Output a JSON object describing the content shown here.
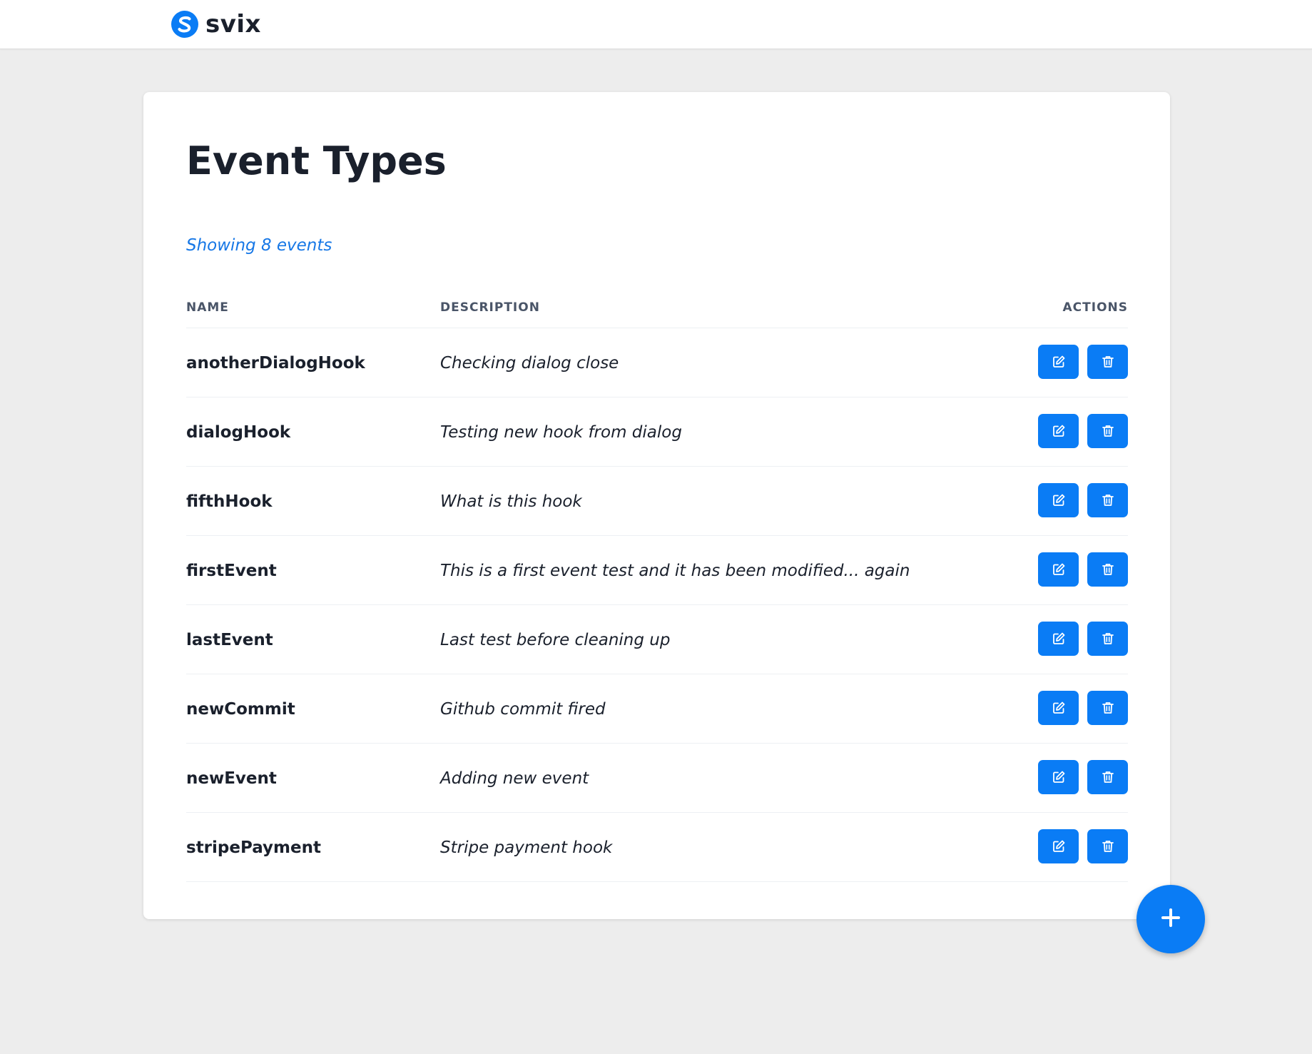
{
  "brand": {
    "name": "svix",
    "logo_icon": "svix-logo-icon"
  },
  "page": {
    "title": "Event Types",
    "count_text": "Showing 8 events"
  },
  "table": {
    "headers": {
      "name": "NAME",
      "description": "DESCRIPTION",
      "actions": "ACTIONS"
    },
    "rows": [
      {
        "name": "anotherDialogHook",
        "description": "Checking dialog close"
      },
      {
        "name": "dialogHook",
        "description": "Testing new hook from dialog"
      },
      {
        "name": "fifthHook",
        "description": "What is this hook"
      },
      {
        "name": "firstEvent",
        "description": "This is a first event test and it has been modified... again"
      },
      {
        "name": "lastEvent",
        "description": "Last test before cleaning up"
      },
      {
        "name": "newCommit",
        "description": "Github commit fired"
      },
      {
        "name": "newEvent",
        "description": "Adding new event"
      },
      {
        "name": "stripePayment",
        "description": "Stripe payment hook"
      }
    ],
    "row_actions": [
      {
        "icon": "edit-icon"
      },
      {
        "icon": "trash-icon"
      }
    ]
  },
  "fab": {
    "icon": "plus-icon"
  },
  "colors": {
    "accent": "#0a7cf5",
    "link": "#1677e6",
    "text": "#1a202c",
    "muted_header": "#4a5568",
    "background": "#ededed",
    "card": "#ffffff"
  }
}
